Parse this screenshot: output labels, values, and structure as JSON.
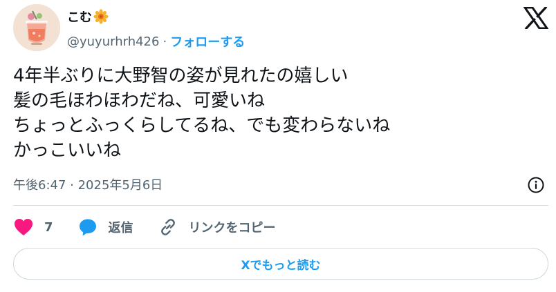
{
  "author": {
    "display_name": "こむ",
    "handle": "@yuyurhrh426",
    "separator": "·",
    "follow_label": "フォローする",
    "avatar_icon": "drink-avatar-icon",
    "name_emoji_icon": "sunflower-icon"
  },
  "brand_icon": "x-logo-icon",
  "tweet": {
    "lines": [
      "4年半ぶりに大野智の姿が見れたの嬉しい",
      "髪の毛ほわほわだね、可愛いね",
      "ちょっとふっくらしてるね、でも変わらないね",
      "かっこいいね"
    ],
    "timestamp": "午後6:47 · 2025年5月6日"
  },
  "actions": {
    "like_count": "7",
    "reply_label": "返信",
    "copy_link_label": "リンクをコピー"
  },
  "read_more_label": "Xでもっと読む",
  "colors": {
    "accent": "#1d9bf0",
    "like": "#f91880",
    "text": "#0f1419",
    "secondary": "#536471",
    "border": "#cfd9de"
  }
}
